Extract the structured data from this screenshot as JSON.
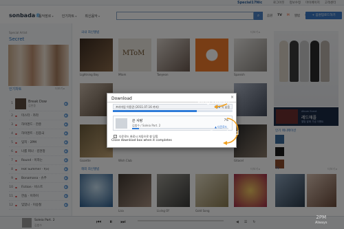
{
  "topbar": {
    "user": "Special17Nic",
    "links": [
      "로그아웃",
      "정보수정",
      "마이페이지",
      "고객센터"
    ]
  },
  "header": {
    "logo_main": "sonbada",
    "logo_dot": "®",
    "nav": [
      "음악장르",
      "인기차트",
      "최신음악"
    ],
    "search_icon": "search-icon",
    "icon_nav": [
      "음원",
      "TV",
      "M",
      "앨범",
      "엔터",
      "마이"
    ],
    "upload_label": "+ 음원업로드하기"
  },
  "left": {
    "special_label": "Special Artist",
    "special_name": "Secret",
    "chart_head": "인기차트",
    "chart_more": "더보기 ▸",
    "first": {
      "rank": "1",
      "title": "Break Dow",
      "artist": "김현중"
    },
    "rows": [
      {
        "rank": "2",
        "title": "미스터 · 카라"
      },
      {
        "rank": "3",
        "title": "하이엔드 · 한준"
      },
      {
        "rank": "4",
        "title": "하이엔트 · 김종국"
      },
      {
        "rank": "5",
        "title": "잊지 · 2PM"
      },
      {
        "rank": "6",
        "title": "나를 떠나 · 김현정"
      },
      {
        "rank": "7",
        "title": "Round · 이하는"
      },
      {
        "rank": "8",
        "title": "Hot Summer · f(x)"
      },
      {
        "rank": "9",
        "title": "Bonamana · 슈주"
      },
      {
        "rank": "10",
        "title": "Fiction · 비스트"
      },
      {
        "rank": "11",
        "title": "한숨 · 이하이"
      },
      {
        "rank": "12",
        "title": "잊었니 · 이승철"
      }
    ]
  },
  "center": {
    "sec1": "국내 최신앨범",
    "sec1_more": "더보기 ▸",
    "sec2": "해외 최신앨범",
    "sec2_more": "더보기 ▸",
    "row1_caps": [
      "Lightning Boy",
      "Mtom",
      "Taeyeon",
      "",
      "Spanish"
    ],
    "row3_caps": [
      "Gazette",
      "Wish Club",
      "",
      "",
      "Gitacel"
    ],
    "row4_caps": [
      "",
      "Lisa",
      "Living Of",
      "Gold Song",
      ""
    ]
  },
  "right": {
    "promo_small": "Album Event",
    "promo_big": "레드애플",
    "promo_sub": "앨범 발매 기념 이벤트",
    "pop_head": "인기 애니메이션",
    "tv_head": "TV",
    "tv_more": "더보기 ▸"
  },
  "dialog": {
    "title": "Download",
    "close_icon": "close-icon",
    "quota_label": "프리미엄 이용권 (2011.07.16 까지)",
    "quota_remaining": "150",
    "quota_suffix": "곡 남음",
    "quota_fraction": 0.7,
    "song_title": "끈 사랑",
    "song_artist": "김범수 / Soleia Part. 2",
    "percent": "7%",
    "progress_fraction": 0.07,
    "download_label": "▲ 다운로드",
    "check_kr": "다운로드 완료시 자동으로 창 닫힘",
    "check_en": "Close download box when it completes"
  },
  "annotations": {
    "quota": "Song Quota",
    "download": "Download"
  },
  "player": {
    "title": "Soleia Part. 2",
    "artist": "김범수",
    "prev_icon": "prev-icon",
    "play_icon": "play-icon",
    "pause_icon": "pause-icon",
    "next_icon": "next-icon"
  },
  "watermark": {
    "line1": "2PM",
    "line2": "Always"
  },
  "colors": {
    "accent": "#2d70b8",
    "annotation_arrow": "#f0a020",
    "upload": "#3a79c4"
  }
}
